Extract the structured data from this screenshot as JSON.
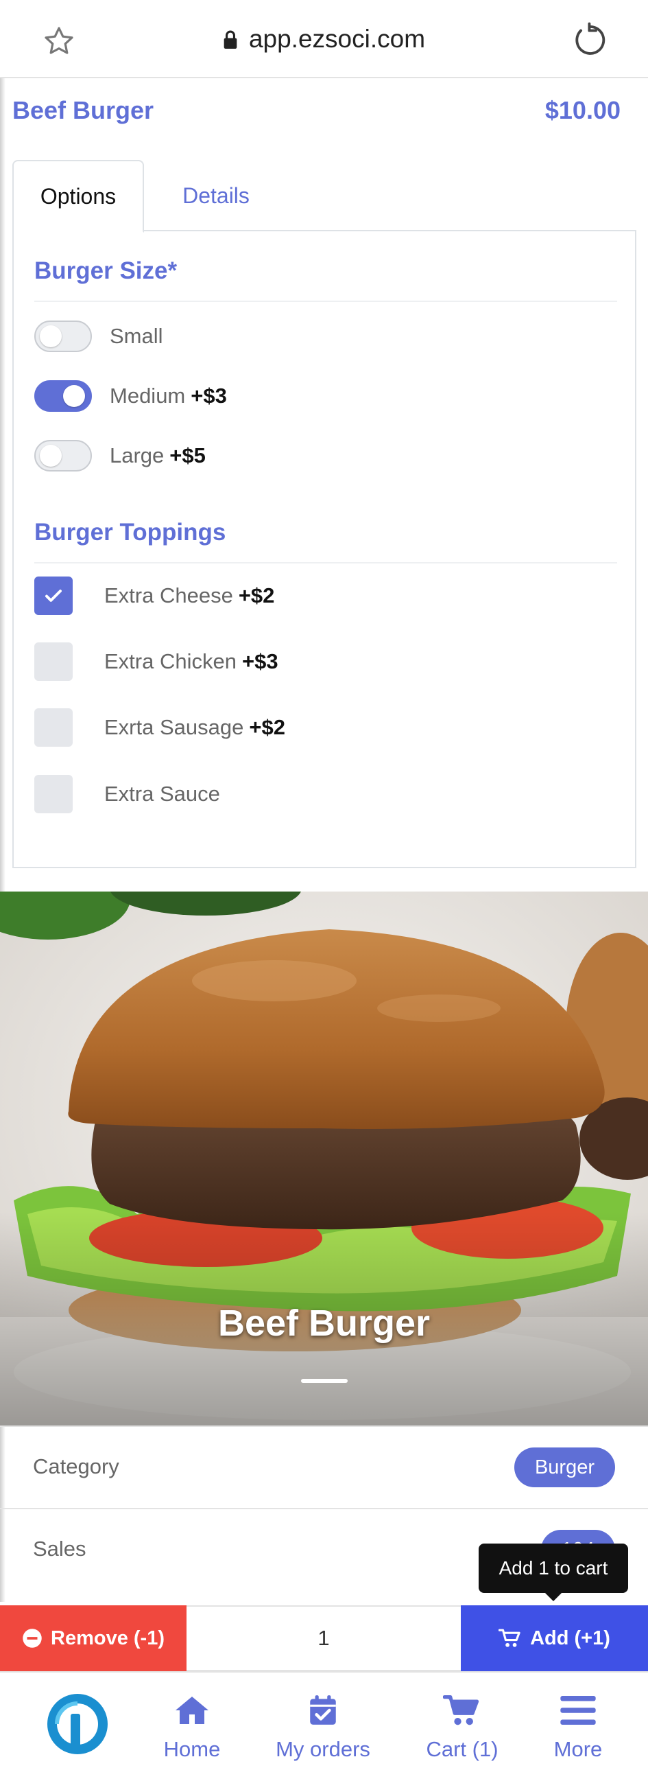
{
  "browser": {
    "url": "app.ezsoci.com"
  },
  "product": {
    "name": "Beef Burger",
    "price": "$10.00"
  },
  "tabs": [
    {
      "label": "Options",
      "active": true
    },
    {
      "label": "Details",
      "active": false
    }
  ],
  "size_section": {
    "title": "Burger Size*",
    "options": [
      {
        "label": "Small",
        "price": "",
        "selected": false
      },
      {
        "label": "Medium",
        "price": "+$3",
        "selected": true
      },
      {
        "label": "Large",
        "price": "+$5",
        "selected": false
      }
    ]
  },
  "toppings_section": {
    "title": "Burger Toppings",
    "options": [
      {
        "label": "Extra Cheese",
        "price": "+$2",
        "checked": true
      },
      {
        "label": "Extra Chicken",
        "price": "+$3",
        "checked": false
      },
      {
        "label": "Exrta Sausage",
        "price": "+$2",
        "checked": false
      },
      {
        "label": "Extra Sauce",
        "price": "",
        "checked": false
      }
    ]
  },
  "hero": {
    "caption": "Beef Burger"
  },
  "info": {
    "category_label": "Category",
    "category_value": "Burger",
    "sales_label": "Sales",
    "sales_value": "104"
  },
  "tooltip": "Add 1 to cart",
  "cart_bar": {
    "remove_label": "Remove (-1)",
    "quantity": "1",
    "add_label": "Add (+1)"
  },
  "nav": {
    "home": "Home",
    "orders": "My orders",
    "cart": "Cart (1)",
    "more": "More"
  },
  "colors": {
    "accent": "#5f6fd6",
    "add": "#3f51e6",
    "remove": "#f0483e"
  }
}
